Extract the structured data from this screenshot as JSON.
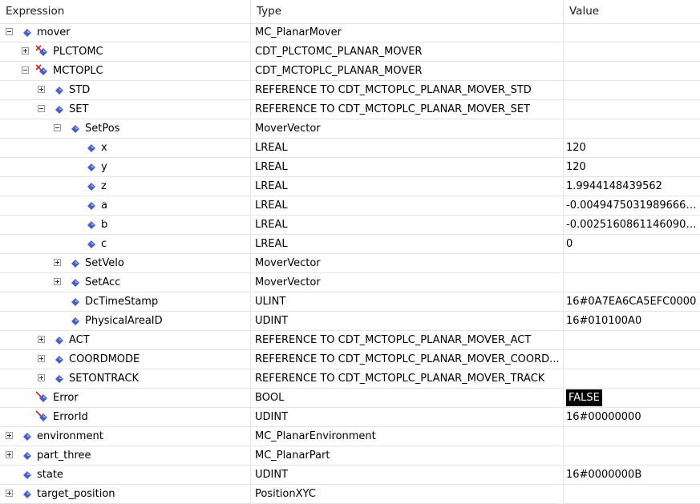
{
  "header": {
    "expression": "Expression",
    "type": "Type",
    "value": "Value"
  },
  "rows": [
    {
      "name": "mover",
      "type": "MC_PlanarMover",
      "value": "",
      "level": 0,
      "expander": "minus",
      "icon": "variable-icon"
    },
    {
      "name": "PLCTOMC",
      "type": "CDT_PLCTOMC_PLANAR_MOVER",
      "value": "",
      "level": 1,
      "expander": "plus",
      "icon": "io-variable-icon"
    },
    {
      "name": "MCTOPLC",
      "type": "CDT_MCTOPLC_PLANAR_MOVER",
      "value": "",
      "level": 1,
      "expander": "minus",
      "icon": "io-variable-icon"
    },
    {
      "name": "STD",
      "type": "REFERENCE TO CDT_MCTOPLC_PLANAR_MOVER_STD",
      "value": "",
      "level": 2,
      "expander": "plus",
      "icon": "variable-icon"
    },
    {
      "name": "SET",
      "type": "REFERENCE TO CDT_MCTOPLC_PLANAR_MOVER_SET",
      "value": "",
      "level": 2,
      "expander": "minus",
      "icon": "variable-icon"
    },
    {
      "name": "SetPos",
      "type": "MoverVector",
      "value": "",
      "level": 3,
      "expander": "minus",
      "icon": "variable-icon"
    },
    {
      "name": "x",
      "type": "LREAL",
      "value": "120",
      "level": 4,
      "expander": "",
      "icon": "variable-icon"
    },
    {
      "name": "y",
      "type": "LREAL",
      "value": "120",
      "level": 4,
      "expander": "",
      "icon": "variable-icon"
    },
    {
      "name": "z",
      "type": "LREAL",
      "value": "1.9944148439562",
      "level": 4,
      "expander": "",
      "icon": "variable-icon"
    },
    {
      "name": "a",
      "type": "LREAL",
      "value": "-0.00494750319896669...",
      "level": 4,
      "expander": "",
      "icon": "variable-icon"
    },
    {
      "name": "b",
      "type": "LREAL",
      "value": "-0.00251608611460904...",
      "level": 4,
      "expander": "",
      "icon": "variable-icon"
    },
    {
      "name": "c",
      "type": "LREAL",
      "value": "0",
      "level": 4,
      "expander": "",
      "icon": "variable-icon"
    },
    {
      "name": "SetVelo",
      "type": "MoverVector",
      "value": "",
      "level": 3,
      "expander": "plus",
      "icon": "variable-icon"
    },
    {
      "name": "SetAcc",
      "type": "MoverVector",
      "value": "",
      "level": 3,
      "expander": "plus",
      "icon": "variable-icon"
    },
    {
      "name": "DcTimeStamp",
      "type": "ULINT",
      "value": "16#0A7EA6CA5EFC0000",
      "level": 3,
      "expander": "",
      "icon": "variable-icon"
    },
    {
      "name": "PhysicalAreaID",
      "type": "UDINT",
      "value": "16#010100A0",
      "level": 3,
      "expander": "",
      "icon": "variable-icon"
    },
    {
      "name": "ACT",
      "type": "REFERENCE TO CDT_MCTOPLC_PLANAR_MOVER_ACT",
      "value": "",
      "level": 2,
      "expander": "plus",
      "icon": "variable-icon"
    },
    {
      "name": "COORDMODE",
      "type": "REFERENCE TO CDT_MCTOPLC_PLANAR_MOVER_COORD...",
      "value": "",
      "level": 2,
      "expander": "plus",
      "icon": "variable-icon"
    },
    {
      "name": "SETONTRACK",
      "type": "REFERENCE TO CDT_MCTOPLC_PLANAR_MOVER_TRACK",
      "value": "",
      "level": 2,
      "expander": "plus",
      "icon": "variable-icon"
    },
    {
      "name": "Error",
      "type": "BOOL",
      "value": "FALSE",
      "level": 1,
      "expander": "",
      "icon": "output-variable-icon",
      "highlight": true
    },
    {
      "name": "ErrorId",
      "type": "UDINT",
      "value": "16#00000000",
      "level": 1,
      "expander": "",
      "icon": "output-variable-icon"
    },
    {
      "name": "environment",
      "type": "MC_PlanarEnvironment",
      "value": "",
      "level": 0,
      "expander": "plus",
      "icon": "variable-icon"
    },
    {
      "name": "part_three",
      "type": "MC_PlanarPart",
      "value": "",
      "level": 0,
      "expander": "plus",
      "icon": "variable-icon"
    },
    {
      "name": "state",
      "type": "UDINT",
      "value": "16#0000000B",
      "level": 0,
      "expander": "",
      "icon": "variable-icon"
    },
    {
      "name": "target_position",
      "type": "PositionXYC",
      "value": "",
      "level": 0,
      "expander": "plus",
      "icon": "variable-icon"
    }
  ],
  "colors": {
    "icon_blue": "#4a5fbf",
    "io_red": "#cc2222"
  }
}
